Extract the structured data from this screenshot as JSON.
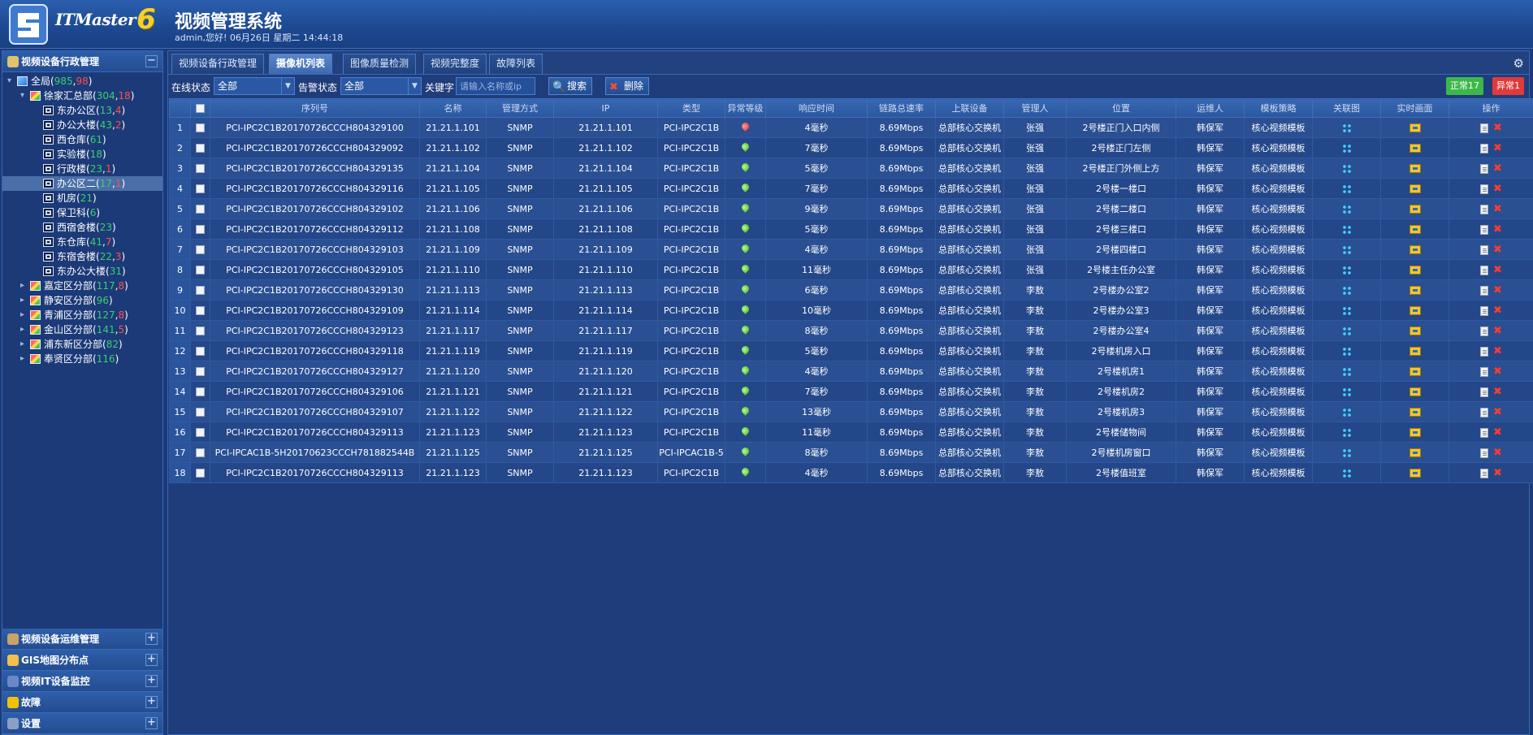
{
  "header": {
    "logo_text": "ITMaster",
    "logo_version": "6",
    "title": "视频管理系统",
    "greeting": "admin,您好! 06月26日 星期二 14:44:18"
  },
  "sidebar": {
    "sections": [
      {
        "label": "视频设备行政管理",
        "toggle": "−",
        "icon_color": "#e0c36a"
      },
      {
        "label": "视频设备运维管理",
        "toggle": "+",
        "icon_color": "#c8a36a"
      },
      {
        "label": "GIS地图分布点",
        "toggle": "+",
        "icon_color": "#f0c04a"
      },
      {
        "label": "视频IT设备监控",
        "toggle": "+",
        "icon_color": "#6a88c8"
      },
      {
        "label": "故障",
        "toggle": "+",
        "icon_color": "#f2c200"
      },
      {
        "label": "设置",
        "toggle": "+",
        "icon_color": "#8aa0c8"
      }
    ],
    "tree": [
      {
        "label": "全局",
        "a": "985",
        "b": "98",
        "depth": 0,
        "icon": "root",
        "twisty": "▾"
      },
      {
        "label": "徐家汇总部",
        "a": "304",
        "b": "18",
        "depth": 1,
        "icon": "branch",
        "twisty": "▾"
      },
      {
        "label": "东办公区",
        "a": "13",
        "b": "4",
        "depth": 2,
        "icon": "leaf"
      },
      {
        "label": "办公大楼",
        "a": "43",
        "b": "2",
        "depth": 2,
        "icon": "leaf"
      },
      {
        "label": "西仓库",
        "a": "61",
        "b": "",
        "depth": 2,
        "icon": "leaf"
      },
      {
        "label": "实验楼",
        "a": "18",
        "b": "",
        "depth": 2,
        "icon": "leaf"
      },
      {
        "label": "行政楼",
        "a": "23",
        "b": "1",
        "depth": 2,
        "icon": "leaf"
      },
      {
        "label": "办公区二",
        "a": "17",
        "b": "1",
        "depth": 2,
        "icon": "leaf",
        "selected": true
      },
      {
        "label": "机房",
        "a": "21",
        "b": "",
        "depth": 2,
        "icon": "leaf"
      },
      {
        "label": "保卫科",
        "a": "6",
        "b": "",
        "depth": 2,
        "icon": "leaf"
      },
      {
        "label": "西宿舍楼",
        "a": "23",
        "b": "",
        "depth": 2,
        "icon": "leaf"
      },
      {
        "label": "东仓库",
        "a": "41",
        "b": "7",
        "depth": 2,
        "icon": "leaf"
      },
      {
        "label": "东宿舍楼",
        "a": "22",
        "b": "3",
        "depth": 2,
        "icon": "leaf"
      },
      {
        "label": "东办公大楼",
        "a": "31",
        "b": "",
        "depth": 2,
        "icon": "leaf"
      },
      {
        "label": "嘉定区分部",
        "a": "117",
        "b": "8",
        "depth": 1,
        "icon": "branch",
        "twisty": "▸"
      },
      {
        "label": "静安区分部",
        "a": "96",
        "b": "",
        "depth": 1,
        "icon": "branch",
        "twisty": "▸"
      },
      {
        "label": "青浦区分部",
        "a": "127",
        "b": "8",
        "depth": 1,
        "icon": "branch",
        "twisty": "▸"
      },
      {
        "label": "金山区分部",
        "a": "141",
        "b": "5",
        "depth": 1,
        "icon": "branch",
        "twisty": "▸"
      },
      {
        "label": "浦东新区分部",
        "a": "82",
        "b": "",
        "depth": 1,
        "icon": "branch",
        "twisty": "▸"
      },
      {
        "label": "奉贤区分部",
        "a": "116",
        "b": "",
        "depth": 1,
        "icon": "branch",
        "twisty": "▸"
      }
    ]
  },
  "tabs": [
    {
      "label": "视频设备行政管理",
      "active": false
    },
    {
      "label": "摄像机列表",
      "active": true
    },
    {
      "label": "图像质量检测",
      "active": false
    },
    {
      "label": "视频完整度",
      "active": false
    },
    {
      "label": "故障列表",
      "active": false
    }
  ],
  "filters": {
    "online_label": "在线状态",
    "online_value": "全部",
    "alarm_label": "告警状态",
    "alarm_value": "全部",
    "keyword_label": "关键字",
    "keyword_placeholder": "请输入名称或ip",
    "search_button": "搜索",
    "delete_button": "删除",
    "normal_badge": "正常17",
    "abnormal_badge": "异常1",
    "normal_color": "#3cb84a",
    "abnormal_color": "#e23a3a"
  },
  "table": {
    "columns": [
      "序列号",
      "名称",
      "管理方式",
      "IP",
      "类型",
      "异常等级",
      "响应时间",
      "链路总速率",
      "上联设备",
      "管理人",
      "位置",
      "运维人",
      "模板策略",
      "关联图",
      "实时画面",
      "操作"
    ],
    "rows": [
      {
        "no": "1",
        "serial": "PCI-IPC2C1B20170726CCCH804329100",
        "name": "21.21.1.101",
        "mgmt": "SNMP",
        "ip": "21.21.1.101",
        "type": "PCI-IPC2C1B",
        "level": "bad",
        "resp": "4毫秒",
        "rate": "8.69Mbps",
        "uplink": "总部核心交换机",
        "admin": "张强",
        "loc": "2号楼正门入口内侧",
        "ops": "韩保军",
        "tpl": "核心视频模板"
      },
      {
        "no": "2",
        "serial": "PCI-IPC2C1B20170726CCCH804329092",
        "name": "21.21.1.102",
        "mgmt": "SNMP",
        "ip": "21.21.1.102",
        "type": "PCI-IPC2C1B",
        "level": "ok",
        "resp": "7毫秒",
        "rate": "8.69Mbps",
        "uplink": "总部核心交换机",
        "admin": "张强",
        "loc": "2号楼正门左侧",
        "ops": "韩保军",
        "tpl": "核心视频模板"
      },
      {
        "no": "3",
        "serial": "PCI-IPC2C1B20170726CCCH804329135",
        "name": "21.21.1.104",
        "mgmt": "SNMP",
        "ip": "21.21.1.104",
        "type": "PCI-IPC2C1B",
        "level": "ok",
        "resp": "5毫秒",
        "rate": "8.69Mbps",
        "uplink": "总部核心交换机",
        "admin": "张强",
        "loc": "2号楼正门外侧上方",
        "ops": "韩保军",
        "tpl": "核心视频模板"
      },
      {
        "no": "4",
        "serial": "PCI-IPC2C1B20170726CCCH804329116",
        "name": "21.21.1.105",
        "mgmt": "SNMP",
        "ip": "21.21.1.105",
        "type": "PCI-IPC2C1B",
        "level": "ok",
        "resp": "7毫秒",
        "rate": "8.69Mbps",
        "uplink": "总部核心交换机",
        "admin": "张强",
        "loc": "2号楼一楼口",
        "ops": "韩保军",
        "tpl": "核心视频模板"
      },
      {
        "no": "5",
        "serial": "PCI-IPC2C1B20170726CCCH804329102",
        "name": "21.21.1.106",
        "mgmt": "SNMP",
        "ip": "21.21.1.106",
        "type": "PCI-IPC2C1B",
        "level": "ok",
        "resp": "9毫秒",
        "rate": "8.69Mbps",
        "uplink": "总部核心交换机",
        "admin": "张强",
        "loc": "2号楼二楼口",
        "ops": "韩保军",
        "tpl": "核心视频模板"
      },
      {
        "no": "6",
        "serial": "PCI-IPC2C1B20170726CCCH804329112",
        "name": "21.21.1.108",
        "mgmt": "SNMP",
        "ip": "21.21.1.108",
        "type": "PCI-IPC2C1B",
        "level": "ok",
        "resp": "5毫秒",
        "rate": "8.69Mbps",
        "uplink": "总部核心交换机",
        "admin": "张强",
        "loc": "2号楼三楼口",
        "ops": "韩保军",
        "tpl": "核心视频模板"
      },
      {
        "no": "7",
        "serial": "PCI-IPC2C1B20170726CCCH804329103",
        "name": "21.21.1.109",
        "mgmt": "SNMP",
        "ip": "21.21.1.109",
        "type": "PCI-IPC2C1B",
        "level": "ok",
        "resp": "4毫秒",
        "rate": "8.69Mbps",
        "uplink": "总部核心交换机",
        "admin": "张强",
        "loc": "2号楼四楼口",
        "ops": "韩保军",
        "tpl": "核心视频模板"
      },
      {
        "no": "8",
        "serial": "PCI-IPC2C1B20170726CCCH804329105",
        "name": "21.21.1.110",
        "mgmt": "SNMP",
        "ip": "21.21.1.110",
        "type": "PCI-IPC2C1B",
        "level": "ok",
        "resp": "11毫秒",
        "rate": "8.69Mbps",
        "uplink": "总部核心交换机",
        "admin": "张强",
        "loc": "2号楼主任办公室",
        "ops": "韩保军",
        "tpl": "核心视频模板"
      },
      {
        "no": "9",
        "serial": "PCI-IPC2C1B20170726CCCH804329130",
        "name": "21.21.1.113",
        "mgmt": "SNMP",
        "ip": "21.21.1.113",
        "type": "PCI-IPC2C1B",
        "level": "ok",
        "resp": "6毫秒",
        "rate": "8.69Mbps",
        "uplink": "总部核心交换机",
        "admin": "李敖",
        "loc": "2号楼办公室2",
        "ops": "韩保军",
        "tpl": "核心视频模板"
      },
      {
        "no": "10",
        "serial": "PCI-IPC2C1B20170726CCCH804329109",
        "name": "21.21.1.114",
        "mgmt": "SNMP",
        "ip": "21.21.1.114",
        "type": "PCI-IPC2C1B",
        "level": "ok",
        "resp": "10毫秒",
        "rate": "8.69Mbps",
        "uplink": "总部核心交换机",
        "admin": "李敖",
        "loc": "2号楼办公室3",
        "ops": "韩保军",
        "tpl": "核心视频模板"
      },
      {
        "no": "11",
        "serial": "PCI-IPC2C1B20170726CCCH804329123",
        "name": "21.21.1.117",
        "mgmt": "SNMP",
        "ip": "21.21.1.117",
        "type": "PCI-IPC2C1B",
        "level": "ok",
        "resp": "8毫秒",
        "rate": "8.69Mbps",
        "uplink": "总部核心交换机",
        "admin": "李敖",
        "loc": "2号楼办公室4",
        "ops": "韩保军",
        "tpl": "核心视频模板"
      },
      {
        "no": "12",
        "serial": "PCI-IPC2C1B20170726CCCH804329118",
        "name": "21.21.1.119",
        "mgmt": "SNMP",
        "ip": "21.21.1.119",
        "type": "PCI-IPC2C1B",
        "level": "ok",
        "resp": "5毫秒",
        "rate": "8.69Mbps",
        "uplink": "总部核心交换机",
        "admin": "李敖",
        "loc": "2号楼机房入口",
        "ops": "韩保军",
        "tpl": "核心视频模板"
      },
      {
        "no": "13",
        "serial": "PCI-IPC2C1B20170726CCCH804329127",
        "name": "21.21.1.120",
        "mgmt": "SNMP",
        "ip": "21.21.1.120",
        "type": "PCI-IPC2C1B",
        "level": "ok",
        "resp": "4毫秒",
        "rate": "8.69Mbps",
        "uplink": "总部核心交换机",
        "admin": "李敖",
        "loc": "2号楼机房1",
        "ops": "韩保军",
        "tpl": "核心视频模板"
      },
      {
        "no": "14",
        "serial": "PCI-IPC2C1B20170726CCCH804329106",
        "name": "21.21.1.121",
        "mgmt": "SNMP",
        "ip": "21.21.1.121",
        "type": "PCI-IPC2C1B",
        "level": "ok",
        "resp": "7毫秒",
        "rate": "8.69Mbps",
        "uplink": "总部核心交换机",
        "admin": "李敖",
        "loc": "2号楼机房2",
        "ops": "韩保军",
        "tpl": "核心视频模板"
      },
      {
        "no": "15",
        "serial": "PCI-IPC2C1B20170726CCCH804329107",
        "name": "21.21.1.122",
        "mgmt": "SNMP",
        "ip": "21.21.1.122",
        "type": "PCI-IPC2C1B",
        "level": "ok",
        "resp": "13毫秒",
        "rate": "8.69Mbps",
        "uplink": "总部核心交换机",
        "admin": "李敖",
        "loc": "2号楼机房3",
        "ops": "韩保军",
        "tpl": "核心视频模板"
      },
      {
        "no": "16",
        "serial": "PCI-IPC2C1B20170726CCCH804329113",
        "name": "21.21.1.123",
        "mgmt": "SNMP",
        "ip": "21.21.1.123",
        "type": "PCI-IPC2C1B",
        "level": "ok",
        "resp": "11毫秒",
        "rate": "8.69Mbps",
        "uplink": "总部核心交换机",
        "admin": "李敖",
        "loc": "2号楼储物间",
        "ops": "韩保军",
        "tpl": "核心视频模板"
      },
      {
        "no": "17",
        "serial": "PCI-IPCAC1B-5H20170623CCCH781882544B",
        "name": "21.21.1.125",
        "mgmt": "SNMP",
        "ip": "21.21.1.125",
        "type": "PCI-IPCAC1B-5",
        "level": "ok",
        "resp": "8毫秒",
        "rate": "8.69Mbps",
        "uplink": "总部核心交换机",
        "admin": "李敖",
        "loc": "2号楼机房窗口",
        "ops": "韩保军",
        "tpl": "核心视频模板"
      },
      {
        "no": "18",
        "serial": "PCI-IPC2C1B20170726CCCH804329113",
        "name": "21.21.1.123",
        "mgmt": "SNMP",
        "ip": "21.21.1.123",
        "type": "PCI-IPC2C1B",
        "level": "ok",
        "resp": "4毫秒",
        "rate": "8.69Mbps",
        "uplink": "总部核心交换机",
        "admin": "李敖",
        "loc": "2号楼值班室",
        "ops": "韩保军",
        "tpl": "核心视频模板"
      }
    ]
  }
}
